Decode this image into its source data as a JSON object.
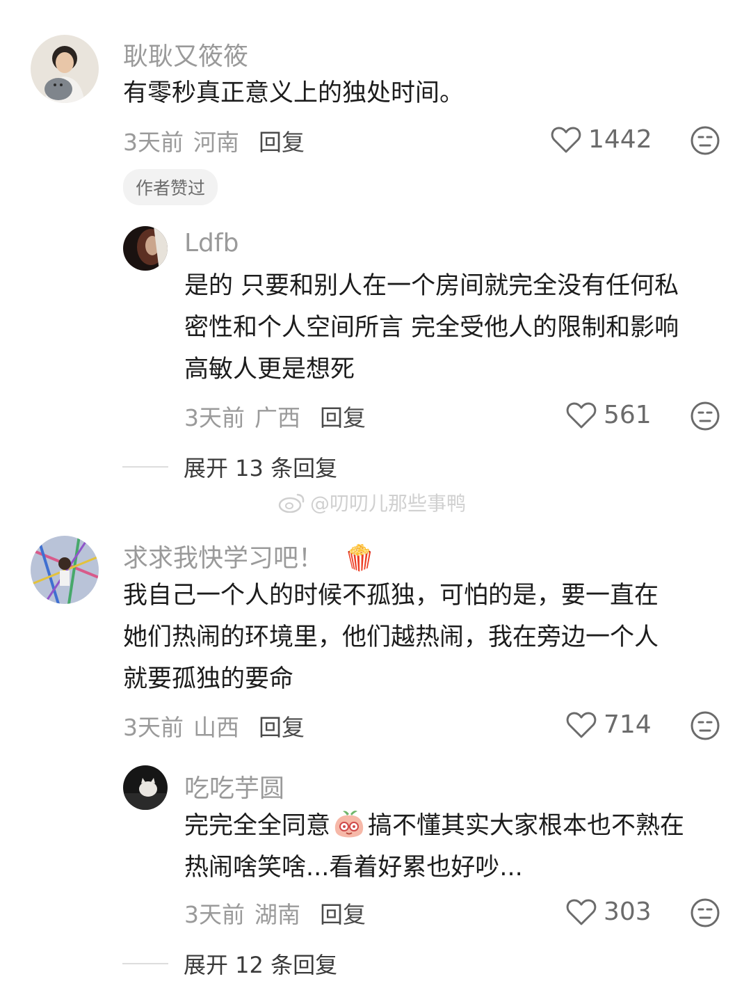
{
  "comments": [
    {
      "username": "耿耿又筱筱",
      "text_lines": [
        "有零秒真正意义上的独处时间。"
      ],
      "time": "3天前",
      "location": "河南",
      "reply_label": "回复",
      "likes": "1442",
      "badge": "作者赞过",
      "replies": [
        {
          "username": "Ldfb",
          "text_lines": [
            "是的 只要和别人在一个房间就完全没有任何私",
            "密性和个人空间所言 完全受他人的限制和影响",
            "高敏人更是想死"
          ],
          "time": "3天前",
          "location": "广西",
          "reply_label": "回复",
          "likes": "561"
        }
      ],
      "expand_label": "展开 13 条回复"
    },
    {
      "username": "求求我快学习吧！",
      "username_emoji": "🍿",
      "text_lines": [
        "我自己一个人的时候不孤独，可怕的是，要一直在",
        "她们热闹的环境里，他们越热闹，我在旁边一个人",
        "就要孤独的要命"
      ],
      "time": "3天前",
      "location": "山西",
      "reply_label": "回复",
      "likes": "714",
      "replies": [
        {
          "username": "吃吃芋圆",
          "text_line1_before": "完完全全同意",
          "text_line1_after": "搞不懂其实大家根本也不熟在",
          "text_line2": "热闹啥笑啥...看着好累也好吵...",
          "time": "3天前",
          "location": "湖南",
          "reply_label": "回复",
          "likes": "303"
        }
      ],
      "expand_label": "展开 12 条回复"
    }
  ],
  "watermark": "@叨叨儿那些事鸭",
  "colors": {
    "username": "#9a9a9a",
    "text": "#1c1c1c",
    "meta": "#9a9a9a",
    "badge_bg": "#f2f2f2"
  }
}
